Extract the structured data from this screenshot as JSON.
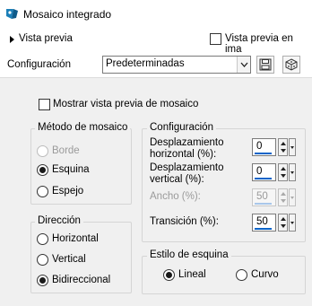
{
  "window": {
    "title": "Mosaico integrado"
  },
  "preview": {
    "label": "Vista previa",
    "checkbox_label": "Vista previa en ima",
    "checked": false
  },
  "config": {
    "label": "Configuración",
    "preset": "Predeterminadas"
  },
  "show_preview": {
    "label": "Mostrar vista previa de mosaico",
    "checked": false
  },
  "tiling_method": {
    "title": "Método de mosaico",
    "options": [
      {
        "label": "Borde",
        "selected": false,
        "disabled": true
      },
      {
        "label": "Esquina",
        "selected": true,
        "disabled": false
      },
      {
        "label": "Espejo",
        "selected": false,
        "disabled": false
      }
    ]
  },
  "settings": {
    "title": "Configuración",
    "horizontal_offset": {
      "label_line1": "Desplazamiento",
      "label_line2": "horizontal (%):",
      "value": "0"
    },
    "vertical_offset": {
      "label_line1": "Desplazamiento",
      "label_line2": "vertical (%):",
      "value": "0"
    },
    "width": {
      "label": "Ancho (%):",
      "value": "50",
      "disabled": true
    },
    "transition": {
      "label": "Transición (%):",
      "value": "50"
    }
  },
  "direction": {
    "title": "Dirección",
    "options": [
      {
        "label": "Horizontal",
        "selected": false
      },
      {
        "label": "Vertical",
        "selected": false
      },
      {
        "label": "Bidireccional",
        "selected": true
      }
    ]
  },
  "corner_style": {
    "title": "Estilo de esquina",
    "options": [
      {
        "label": "Lineal",
        "selected": true
      },
      {
        "label": "Curvo",
        "selected": false
      }
    ]
  }
}
